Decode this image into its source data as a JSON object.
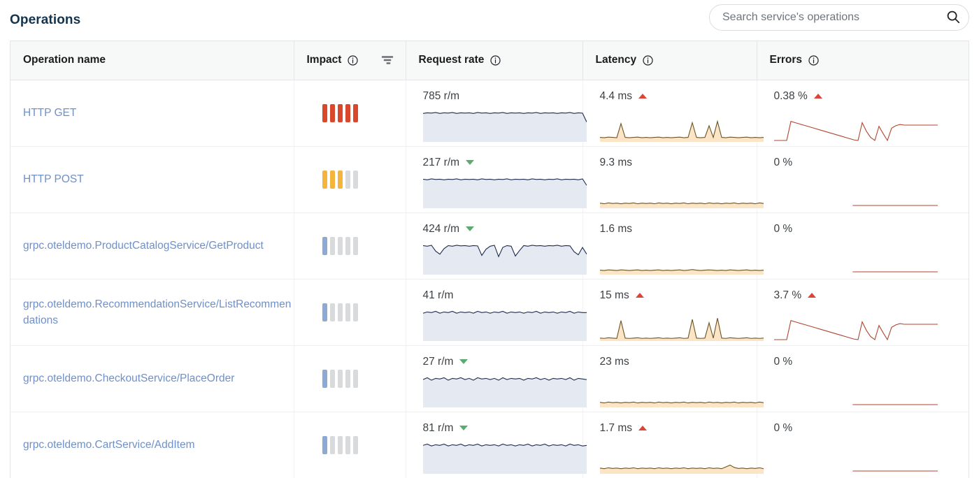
{
  "header": {
    "title": "Operations",
    "search_placeholder": "Search service's operations",
    "search_value": "",
    "search_icon": "search-icon"
  },
  "table": {
    "columns": [
      {
        "key": "name",
        "label": "Operation name",
        "info": false,
        "sort": false
      },
      {
        "key": "impact",
        "label": "Impact",
        "info": true,
        "sort": true
      },
      {
        "key": "rate",
        "label": "Request rate",
        "info": true,
        "sort": false
      },
      {
        "key": "latency",
        "label": "Latency",
        "info": true,
        "sort": false
      },
      {
        "key": "errors",
        "label": "Errors",
        "info": true,
        "sort": false
      }
    ],
    "impact_colors": {
      "red": "#d9482b",
      "orange": "#f5b53d",
      "blue": "#8da9d6",
      "empty": "#d9dadc"
    },
    "rows": [
      {
        "name": "HTTP GET",
        "impact_filled": 5,
        "impact_color": "red",
        "rate_value": "785 r/m",
        "rate_trend": "none",
        "latency_value": "4.4 ms",
        "latency_trend": "up",
        "errors_value": "0.38 %",
        "errors_trend": "up",
        "errors_zero": false
      },
      {
        "name": "HTTP POST",
        "impact_filled": 3,
        "impact_color": "orange",
        "rate_value": "217 r/m",
        "rate_trend": "down",
        "latency_value": "9.3 ms",
        "latency_trend": "none",
        "errors_value": "0 %",
        "errors_trend": "none",
        "errors_zero": true
      },
      {
        "name": "grpc.oteldemo.ProductCatalogService/GetProduct",
        "impact_filled": 1,
        "impact_color": "blue",
        "rate_value": "424 r/m",
        "rate_trend": "down",
        "latency_value": "1.6 ms",
        "latency_trend": "none",
        "errors_value": "0 %",
        "errors_trend": "none",
        "errors_zero": true
      },
      {
        "name": "grpc.oteldemo.RecommendationService/ListRecommendations",
        "impact_filled": 1,
        "impact_color": "blue",
        "rate_value": "41 r/m",
        "rate_trend": "none",
        "latency_value": "15 ms",
        "latency_trend": "up",
        "errors_value": "3.7 %",
        "errors_trend": "up",
        "errors_zero": false
      },
      {
        "name": "grpc.oteldemo.CheckoutService/PlaceOrder",
        "impact_filled": 1,
        "impact_color": "blue",
        "rate_value": "27 r/m",
        "rate_trend": "down",
        "latency_value": "23 ms",
        "latency_trend": "none",
        "errors_value": "0 %",
        "errors_trend": "none",
        "errors_zero": true
      },
      {
        "name": "grpc.oteldemo.CartService/AddItem",
        "impact_filled": 1,
        "impact_color": "blue",
        "rate_value": "81 r/m",
        "rate_trend": "down",
        "latency_value": "1.7 ms",
        "latency_trend": "up",
        "errors_value": "0 %",
        "errors_trend": "none",
        "errors_zero": true
      }
    ]
  },
  "chart_data": {
    "type": "area",
    "title": "Operations sparklines",
    "series_styles": {
      "request_rate": {
        "line": "#1f2b4d",
        "fill": "#e4e9f2"
      },
      "latency": {
        "line": "#6b5524",
        "fill": "#fbe5c6"
      },
      "errors": {
        "line": "#b0462f",
        "fill": "#fbe2dd"
      }
    },
    "rows": [
      {
        "name": "HTTP GET",
        "request_rate": [
          88,
          90,
          89,
          91,
          88,
          90,
          89,
          91,
          88,
          90,
          89,
          90,
          88,
          91,
          89,
          90,
          88,
          90,
          89,
          91,
          88,
          90,
          89,
          90,
          88,
          90,
          89,
          91,
          88,
          90,
          89,
          90,
          88,
          90,
          89,
          91,
          88,
          90,
          89,
          60
        ],
        "latency": [
          10,
          9,
          11,
          10,
          9,
          55,
          10,
          9,
          10,
          11,
          9,
          10,
          9,
          10,
          11,
          9,
          10,
          9,
          10,
          11,
          9,
          10,
          58,
          10,
          9,
          10,
          48,
          10,
          62,
          10,
          9,
          11,
          10,
          9,
          10,
          11,
          9,
          10,
          9,
          10
        ],
        "errors": [
          0,
          0,
          0,
          0,
          62,
          58,
          54,
          50,
          46,
          42,
          38,
          34,
          30,
          26,
          22,
          18,
          14,
          10,
          6,
          2,
          0,
          58,
          30,
          10,
          0,
          46,
          22,
          0,
          40,
          48,
          52,
          50,
          50,
          50,
          50,
          50,
          50,
          50,
          50,
          50
        ]
      },
      {
        "name": "HTTP POST",
        "request_rate": [
          90,
          88,
          91,
          89,
          90,
          88,
          90,
          89,
          91,
          88,
          90,
          89,
          90,
          88,
          91,
          89,
          90,
          88,
          90,
          89,
          91,
          88,
          90,
          89,
          90,
          88,
          91,
          89,
          90,
          88,
          90,
          89,
          91,
          88,
          90,
          89,
          90,
          88,
          91,
          70
        ],
        "latency": [
          12,
          10,
          13,
          11,
          12,
          10,
          12,
          11,
          13,
          10,
          12,
          11,
          12,
          10,
          13,
          11,
          12,
          10,
          12,
          11,
          13,
          10,
          12,
          11,
          12,
          10,
          13,
          11,
          12,
          10,
          12,
          11,
          13,
          10,
          12,
          11,
          12,
          10,
          13,
          11
        ],
        "errors": [
          0,
          0,
          0,
          0,
          0,
          0,
          0,
          0,
          0,
          0,
          0,
          0,
          0,
          0,
          0,
          0,
          0,
          0,
          0,
          0,
          0,
          0,
          0,
          0,
          0,
          0,
          0,
          0,
          0,
          0,
          0,
          0,
          0,
          0,
          0,
          0,
          0,
          0,
          0,
          0
        ]
      },
      {
        "name": "grpc.oteldemo.ProductCatalogService/GetProduct",
        "request_rate": [
          90,
          88,
          91,
          72,
          62,
          80,
          90,
          88,
          91,
          89,
          90,
          88,
          90,
          89,
          58,
          78,
          88,
          91,
          54,
          84,
          90,
          88,
          56,
          74,
          90,
          88,
          91,
          89,
          90,
          88,
          90,
          89,
          91,
          88,
          90,
          89,
          70,
          60,
          84,
          62
        ],
        "latency": [
          10,
          9,
          11,
          10,
          9,
          11,
          10,
          9,
          10,
          11,
          9,
          10,
          9,
          10,
          11,
          9,
          10,
          9,
          10,
          11,
          9,
          10,
          12,
          10,
          9,
          10,
          11,
          10,
          9,
          10,
          9,
          11,
          10,
          9,
          10,
          11,
          9,
          10,
          9,
          10
        ],
        "errors": [
          0,
          0,
          0,
          0,
          0,
          0,
          0,
          0,
          0,
          0,
          0,
          0,
          0,
          0,
          0,
          0,
          0,
          0,
          0,
          0,
          0,
          0,
          0,
          0,
          0,
          0,
          0,
          0,
          0,
          0,
          0,
          0,
          0,
          0,
          0,
          0,
          0,
          0,
          0,
          0
        ]
      },
      {
        "name": "grpc.oteldemo.RecommendationService/ListRecommendations",
        "request_rate": [
          86,
          90,
          88,
          92,
          86,
          90,
          88,
          92,
          86,
          90,
          88,
          90,
          86,
          92,
          88,
          90,
          86,
          90,
          88,
          92,
          86,
          90,
          88,
          90,
          86,
          90,
          88,
          92,
          86,
          90,
          88,
          90,
          86,
          90,
          88,
          92,
          86,
          90,
          88,
          88
        ],
        "latency": [
          5,
          4,
          6,
          5,
          4,
          62,
          5,
          4,
          5,
          6,
          4,
          5,
          4,
          5,
          6,
          4,
          5,
          4,
          5,
          6,
          4,
          5,
          66,
          5,
          4,
          5,
          55,
          5,
          70,
          5,
          4,
          6,
          5,
          4,
          5,
          6,
          4,
          5,
          4,
          5
        ],
        "errors": [
          0,
          0,
          0,
          0,
          62,
          58,
          54,
          50,
          46,
          42,
          38,
          34,
          30,
          26,
          22,
          18,
          14,
          10,
          6,
          2,
          0,
          58,
          30,
          10,
          0,
          46,
          22,
          0,
          40,
          48,
          52,
          50,
          50,
          50,
          50,
          50,
          50,
          50,
          50,
          50
        ]
      },
      {
        "name": "grpc.oteldemo.CheckoutService/PlaceOrder",
        "request_rate": [
          86,
          92,
          84,
          90,
          88,
          92,
          84,
          90,
          88,
          92,
          86,
          90,
          84,
          92,
          88,
          90,
          86,
          90,
          84,
          92,
          86,
          90,
          88,
          90,
          84,
          90,
          88,
          92,
          86,
          90,
          84,
          90,
          88,
          90,
          86,
          92,
          84,
          90,
          88,
          86
        ],
        "latency": [
          12,
          10,
          13,
          11,
          12,
          10,
          12,
          11,
          13,
          10,
          12,
          11,
          12,
          10,
          13,
          11,
          12,
          10,
          12,
          11,
          13,
          10,
          12,
          11,
          12,
          10,
          13,
          11,
          12,
          10,
          12,
          11,
          13,
          10,
          12,
          11,
          12,
          10,
          13,
          11
        ],
        "errors": [
          0,
          0,
          0,
          0,
          0,
          0,
          0,
          0,
          0,
          0,
          0,
          0,
          0,
          0,
          0,
          0,
          0,
          0,
          0,
          0,
          0,
          0,
          0,
          0,
          0,
          0,
          0,
          0,
          0,
          0,
          0,
          0,
          0,
          0,
          0,
          0,
          0,
          0,
          0,
          0
        ]
      },
      {
        "name": "grpc.oteldemo.CartService/AddItem",
        "request_rate": [
          88,
          92,
          86,
          90,
          88,
          92,
          86,
          90,
          88,
          92,
          86,
          90,
          88,
          92,
          86,
          90,
          88,
          90,
          86,
          92,
          88,
          90,
          86,
          90,
          88,
          92,
          86,
          90,
          88,
          92,
          86,
          90,
          88,
          90,
          86,
          92,
          88,
          90,
          86,
          88
        ],
        "latency": [
          14,
          12,
          15,
          13,
          14,
          12,
          14,
          13,
          15,
          12,
          14,
          13,
          14,
          12,
          15,
          13,
          14,
          12,
          14,
          13,
          15,
          12,
          14,
          13,
          14,
          12,
          15,
          13,
          14,
          12,
          18,
          24,
          16,
          13,
          14,
          12,
          14,
          13,
          15,
          12
        ],
        "errors": [
          0,
          0,
          0,
          0,
          0,
          0,
          0,
          0,
          0,
          0,
          0,
          0,
          0,
          0,
          0,
          0,
          0,
          0,
          0,
          0,
          0,
          0,
          0,
          0,
          0,
          0,
          0,
          0,
          0,
          0,
          0,
          0,
          0,
          0,
          0,
          0,
          0,
          0,
          0,
          0
        ]
      }
    ]
  }
}
